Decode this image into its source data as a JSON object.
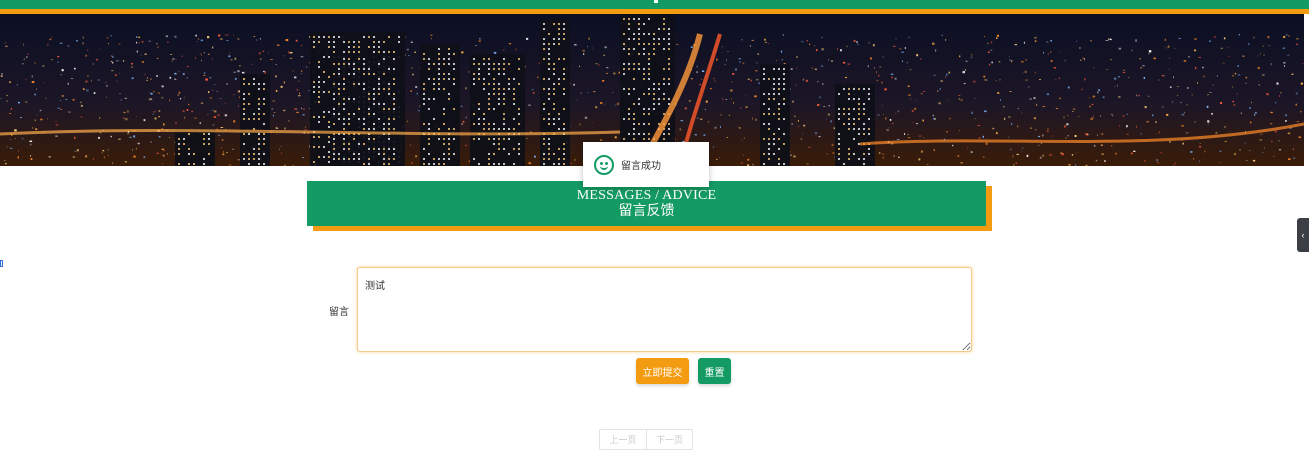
{
  "toast": {
    "icon": "smile-icon",
    "text": "留言成功"
  },
  "section": {
    "title_en": "MESSAGES / ADVICE",
    "title_cn": "留言反馈"
  },
  "form": {
    "label": "留言",
    "textarea_value": "测试",
    "submit_label": "立即提交",
    "reset_label": "重置"
  },
  "pagination": {
    "prev_label": "上一页",
    "next_label": "下一页"
  },
  "side_tab": {
    "icon": "chevron-left-icon",
    "glyph": "‹"
  },
  "colors": {
    "primary": "#149a63",
    "accent": "#f39c12",
    "text": "#333333"
  },
  "banner": {
    "image": "city-night-skyline"
  }
}
